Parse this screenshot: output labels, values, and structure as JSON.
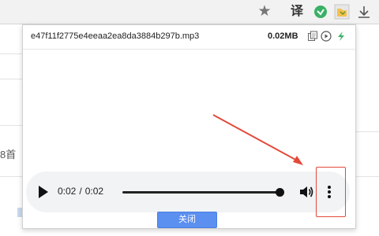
{
  "toolbar": {
    "translate_label": "译"
  },
  "background": {
    "side_text": "8首"
  },
  "popup": {
    "filename": "e47f11f2775e4eeaa2ea8da3884b297b.mp3",
    "filesize": "0.02MB",
    "player": {
      "current_time": "0:02",
      "separator": "/",
      "duration": "0:02",
      "progress_fraction": 1.0
    },
    "close_label": "关闭"
  },
  "colors": {
    "accent": "#5b8ff0",
    "annotation": "#e34a3b",
    "download_green": "#3ab065"
  }
}
